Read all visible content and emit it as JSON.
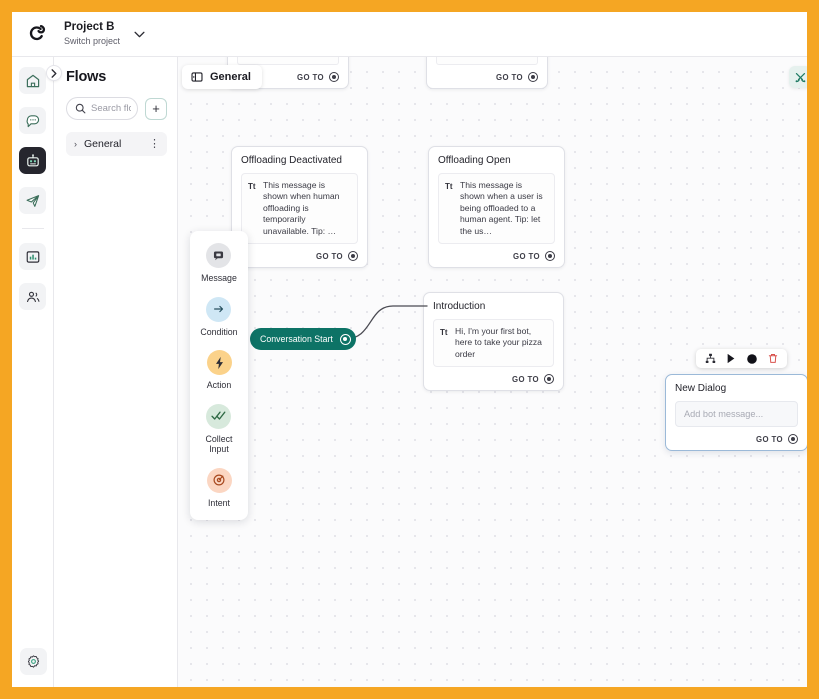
{
  "header": {
    "logo_icon": "loop-logo-icon",
    "project_name": "Project B",
    "project_sub": "Switch project",
    "chevron_icon": "chevron-down-icon"
  },
  "rail": {
    "items": [
      {
        "name": "home",
        "icon": "home-icon",
        "active": false
      },
      {
        "name": "conversations",
        "icon": "chat-bubble-icon",
        "active": false
      },
      {
        "name": "bot-builder",
        "icon": "robot-icon",
        "active": true
      },
      {
        "name": "broadcast",
        "icon": "paper-plane-icon",
        "active": false
      },
      {
        "name": "analytics",
        "icon": "bar-chart-icon",
        "active": false
      },
      {
        "name": "contacts",
        "icon": "people-icon",
        "active": false
      }
    ],
    "settings": {
      "name": "settings",
      "icon": "gear-icon"
    }
  },
  "flows_panel": {
    "title": "Flows",
    "collapse_icon": "chevron-right-icon",
    "search": {
      "icon": "search-icon",
      "placeholder": "Search flows",
      "value": ""
    },
    "add_label": "+",
    "items": [
      {
        "caret": "›",
        "label": "General",
        "menu": "⋮"
      }
    ]
  },
  "canvas": {
    "breadcrumb": {
      "icon": "panel-icon",
      "label": "General"
    },
    "tools_button": {
      "icon": "tools-icon"
    },
    "goto_label": "GO TO",
    "nodes": [
      {
        "id": "clipped-1",
        "title": "",
        "message": "",
        "goto": "GO TO",
        "clipped": true
      },
      {
        "id": "clipped-2",
        "title": "",
        "message": "",
        "goto": "GO TO",
        "clipped": true
      },
      {
        "id": "offloading-deactivated",
        "title": "Offloading Deactivated",
        "text_icon": "Tt",
        "message": "This message is shown when human offloading is temporarily unavailable. Tip: …",
        "goto": "GO TO"
      },
      {
        "id": "offloading-open",
        "title": "Offloading Open",
        "text_icon": "Tt",
        "message": "This message is shown when a user is being offloaded to a human agent. Tip: let the us…",
        "goto": "GO TO"
      },
      {
        "id": "introduction",
        "title": "Introduction",
        "text_icon": "Tt",
        "message": "Hi, I'm your first bot, here to take your pizza order",
        "goto": "GO TO"
      },
      {
        "id": "new-dialog",
        "title": "New Dialog",
        "placeholder": "Add bot message...",
        "goto": "GO TO",
        "selected": true
      }
    ],
    "start_node": {
      "label": "Conversation Start",
      "color": "#0d7366"
    },
    "node_toolbar": {
      "buttons": [
        {
          "name": "hierarchy",
          "icon": "sitemap-icon",
          "color": "#2a2a33"
        },
        {
          "name": "play",
          "icon": "play-icon",
          "color": "#17171e"
        },
        {
          "name": "record",
          "icon": "circle-filled-icon",
          "color": "#111118"
        },
        {
          "name": "delete",
          "icon": "trash-icon",
          "color": "#d9534f"
        }
      ]
    }
  },
  "palette": {
    "items": [
      {
        "label": "Message",
        "icon": "message-square-icon",
        "bg": "#e3e4e7",
        "fg": "#3a3a42"
      },
      {
        "label": "Condition",
        "icon": "arrow-right-icon",
        "bg": "#cfe7f5",
        "fg": "#27505f"
      },
      {
        "label": "Action",
        "icon": "lightning-bolt-icon",
        "bg": "#fbd28a",
        "fg": "#3a3a42"
      },
      {
        "label": "Collect\nInput",
        "icon": "double-check-icon",
        "bg": "#d7e9dc",
        "fg": "#2f6a45"
      },
      {
        "label": "Intent",
        "icon": "target-icon",
        "bg": "#fbd6c2",
        "fg": "#a8491f"
      }
    ]
  },
  "theme": {
    "frame": "#f5a623",
    "accent_teal": "#0d7366",
    "selected_border": "#9bb9d8",
    "canvas_bg": "#fbfbfc"
  }
}
